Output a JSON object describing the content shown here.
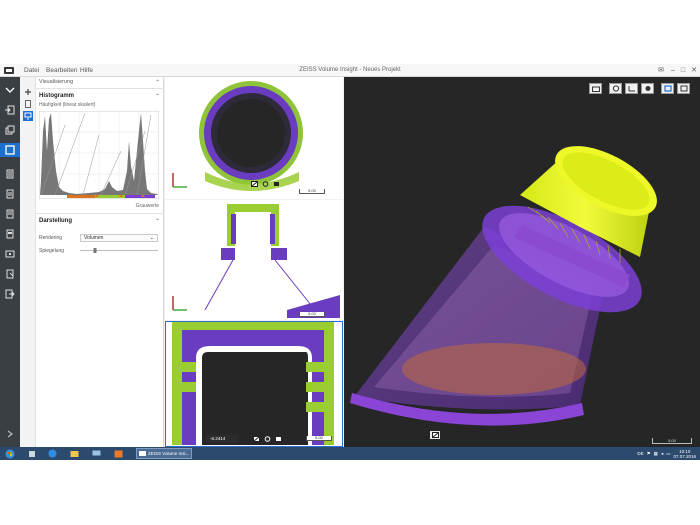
{
  "window": {
    "title": "ZEISS Volume Insight - Neues Projekt",
    "menu": [
      "Datei",
      "Bearbeiten",
      "Hilfe"
    ]
  },
  "panel": {
    "section_tab": "Visualisierung",
    "histogram": {
      "title": "Histogramm",
      "subtitle": "Häufigkeit (linear skaliert)",
      "x_label": "Grauwerte"
    },
    "display": {
      "title": "Darstellung",
      "rendering_label": "Rendering",
      "rendering_value": "Volumen",
      "mirror_label": "Spiegelung",
      "mirror_level": 0.18
    }
  },
  "slices": {
    "coordinate_value": "-6.2414",
    "scale_labels": [
      "5.00",
      "5.00",
      "5.00"
    ]
  },
  "view3d": {
    "scale_label": "5.00"
  },
  "taskbar": {
    "app_label": "ZEISS Volume Insi...",
    "language": "DE",
    "time": "10:10",
    "date": "07.07.2016"
  },
  "colors": {
    "accent": "#1d6fd0",
    "material_green": "#9acd32",
    "material_purple": "#7b3fd6",
    "cap_yellow": "#e6f01e"
  }
}
